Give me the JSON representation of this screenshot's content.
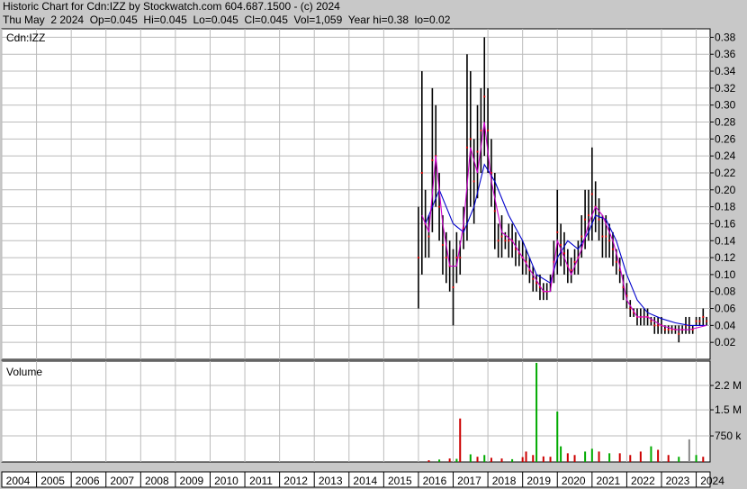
{
  "header": {
    "line1": "Historic Chart for Cdn:IZZ by Stockwatch.com 604.687.1500 - (c) 2024",
    "line2": "Thu May  2 2024  Op=0.045  Hi=0.045  Lo=0.045  Cl=0.045  Vol=1,059  Year hi=0.38  lo=0.02"
  },
  "chart_data": {
    "type": "line",
    "symbol_label": "Cdn:IZZ",
    "volume_label": "Volume",
    "x_ticks": [
      "2004",
      "2005",
      "2006",
      "2007",
      "2008",
      "2009",
      "2010",
      "2011",
      "2012",
      "2013",
      "2014",
      "2015",
      "2016",
      "2017",
      "2018",
      "2019",
      "2020",
      "2021",
      "2022",
      "2023",
      "2024"
    ],
    "x_range": [
      2004.0,
      2024.4
    ],
    "price": {
      "ylim": [
        0,
        0.39
      ],
      "y_ticks": [
        "0.02",
        "0.04",
        "0.06",
        "0.08",
        "0.10",
        "0.12",
        "0.14",
        "0.16",
        "0.18",
        "0.20",
        "0.22",
        "0.24",
        "0.26",
        "0.28",
        "0.30",
        "0.32",
        "0.34",
        "0.36",
        "0.38"
      ],
      "high_low": [
        {
          "t": 2016.0,
          "lo": 0.06,
          "hi": 0.18
        },
        {
          "t": 2016.1,
          "lo": 0.1,
          "hi": 0.34
        },
        {
          "t": 2016.2,
          "lo": 0.12,
          "hi": 0.2
        },
        {
          "t": 2016.3,
          "lo": 0.12,
          "hi": 0.17
        },
        {
          "t": 2016.4,
          "lo": 0.15,
          "hi": 0.32
        },
        {
          "t": 2016.5,
          "lo": 0.18,
          "hi": 0.3
        },
        {
          "t": 2016.6,
          "lo": 0.14,
          "hi": 0.22
        },
        {
          "t": 2016.7,
          "lo": 0.1,
          "hi": 0.17
        },
        {
          "t": 2016.8,
          "lo": 0.09,
          "hi": 0.15
        },
        {
          "t": 2016.9,
          "lo": 0.08,
          "hi": 0.14
        },
        {
          "t": 2017.0,
          "lo": 0.04,
          "hi": 0.13
        },
        {
          "t": 2017.1,
          "lo": 0.09,
          "hi": 0.15
        },
        {
          "t": 2017.2,
          "lo": 0.1,
          "hi": 0.14
        },
        {
          "t": 2017.3,
          "lo": 0.13,
          "hi": 0.18
        },
        {
          "t": 2017.4,
          "lo": 0.14,
          "hi": 0.36
        },
        {
          "t": 2017.5,
          "lo": 0.18,
          "hi": 0.34
        },
        {
          "t": 2017.6,
          "lo": 0.16,
          "hi": 0.26
        },
        {
          "t": 2017.7,
          "lo": 0.19,
          "hi": 0.3
        },
        {
          "t": 2017.8,
          "lo": 0.22,
          "hi": 0.32
        },
        {
          "t": 2017.9,
          "lo": 0.24,
          "hi": 0.38
        },
        {
          "t": 2018.0,
          "lo": 0.22,
          "hi": 0.32
        },
        {
          "t": 2018.1,
          "lo": 0.18,
          "hi": 0.26
        },
        {
          "t": 2018.2,
          "lo": 0.13,
          "hi": 0.22
        },
        {
          "t": 2018.3,
          "lo": 0.12,
          "hi": 0.16
        },
        {
          "t": 2018.4,
          "lo": 0.12,
          "hi": 0.17
        },
        {
          "t": 2018.5,
          "lo": 0.13,
          "hi": 0.15
        },
        {
          "t": 2018.6,
          "lo": 0.12,
          "hi": 0.16
        },
        {
          "t": 2018.7,
          "lo": 0.12,
          "hi": 0.16
        },
        {
          "t": 2018.8,
          "lo": 0.11,
          "hi": 0.15
        },
        {
          "t": 2018.9,
          "lo": 0.11,
          "hi": 0.14
        },
        {
          "t": 2019.0,
          "lo": 0.1,
          "hi": 0.14
        },
        {
          "t": 2019.1,
          "lo": 0.1,
          "hi": 0.13
        },
        {
          "t": 2019.2,
          "lo": 0.09,
          "hi": 0.12
        },
        {
          "t": 2019.3,
          "lo": 0.08,
          "hi": 0.11
        },
        {
          "t": 2019.4,
          "lo": 0.08,
          "hi": 0.1
        },
        {
          "t": 2019.5,
          "lo": 0.07,
          "hi": 0.1
        },
        {
          "t": 2019.6,
          "lo": 0.07,
          "hi": 0.09
        },
        {
          "t": 2019.7,
          "lo": 0.07,
          "hi": 0.09
        },
        {
          "t": 2019.8,
          "lo": 0.08,
          "hi": 0.1
        },
        {
          "t": 2019.9,
          "lo": 0.09,
          "hi": 0.14
        },
        {
          "t": 2020.0,
          "lo": 0.1,
          "hi": 0.2
        },
        {
          "t": 2020.1,
          "lo": 0.11,
          "hi": 0.16
        },
        {
          "t": 2020.2,
          "lo": 0.1,
          "hi": 0.15
        },
        {
          "t": 2020.3,
          "lo": 0.09,
          "hi": 0.13
        },
        {
          "t": 2020.4,
          "lo": 0.09,
          "hi": 0.12
        },
        {
          "t": 2020.5,
          "lo": 0.1,
          "hi": 0.13
        },
        {
          "t": 2020.6,
          "lo": 0.1,
          "hi": 0.14
        },
        {
          "t": 2020.7,
          "lo": 0.12,
          "hi": 0.17
        },
        {
          "t": 2020.8,
          "lo": 0.13,
          "hi": 0.2
        },
        {
          "t": 2020.9,
          "lo": 0.14,
          "hi": 0.2
        },
        {
          "t": 2021.0,
          "lo": 0.14,
          "hi": 0.25
        },
        {
          "t": 2021.1,
          "lo": 0.15,
          "hi": 0.21
        },
        {
          "t": 2021.2,
          "lo": 0.14,
          "hi": 0.19
        },
        {
          "t": 2021.3,
          "lo": 0.12,
          "hi": 0.17
        },
        {
          "t": 2021.4,
          "lo": 0.12,
          "hi": 0.17
        },
        {
          "t": 2021.5,
          "lo": 0.12,
          "hi": 0.16
        },
        {
          "t": 2021.6,
          "lo": 0.11,
          "hi": 0.15
        },
        {
          "t": 2021.7,
          "lo": 0.1,
          "hi": 0.13
        },
        {
          "t": 2021.8,
          "lo": 0.09,
          "hi": 0.12
        },
        {
          "t": 2021.9,
          "lo": 0.07,
          "hi": 0.1
        },
        {
          "t": 2022.0,
          "lo": 0.06,
          "hi": 0.09
        },
        {
          "t": 2022.1,
          "lo": 0.05,
          "hi": 0.07
        },
        {
          "t": 2022.2,
          "lo": 0.05,
          "hi": 0.06
        },
        {
          "t": 2022.3,
          "lo": 0.04,
          "hi": 0.06
        },
        {
          "t": 2022.4,
          "lo": 0.04,
          "hi": 0.06
        },
        {
          "t": 2022.5,
          "lo": 0.04,
          "hi": 0.06
        },
        {
          "t": 2022.6,
          "lo": 0.04,
          "hi": 0.06
        },
        {
          "t": 2022.7,
          "lo": 0.04,
          "hi": 0.05
        },
        {
          "t": 2022.8,
          "lo": 0.03,
          "hi": 0.05
        },
        {
          "t": 2022.9,
          "lo": 0.03,
          "hi": 0.05
        },
        {
          "t": 2023.0,
          "lo": 0.03,
          "hi": 0.05
        },
        {
          "t": 2023.1,
          "lo": 0.03,
          "hi": 0.04
        },
        {
          "t": 2023.2,
          "lo": 0.03,
          "hi": 0.04
        },
        {
          "t": 2023.3,
          "lo": 0.03,
          "hi": 0.04
        },
        {
          "t": 2023.4,
          "lo": 0.03,
          "hi": 0.04
        },
        {
          "t": 2023.5,
          "lo": 0.02,
          "hi": 0.04
        },
        {
          "t": 2023.6,
          "lo": 0.03,
          "hi": 0.04
        },
        {
          "t": 2023.7,
          "lo": 0.03,
          "hi": 0.05
        },
        {
          "t": 2023.8,
          "lo": 0.03,
          "hi": 0.05
        },
        {
          "t": 2023.9,
          "lo": 0.03,
          "hi": 0.04
        },
        {
          "t": 2024.0,
          "lo": 0.04,
          "hi": 0.05
        },
        {
          "t": 2024.1,
          "lo": 0.04,
          "hi": 0.05
        },
        {
          "t": 2024.2,
          "lo": 0.04,
          "hi": 0.06
        },
        {
          "t": 2024.3,
          "lo": 0.04,
          "hi": 0.05
        }
      ],
      "series": [
        {
          "color": "#0000cc",
          "points": [
            [
              2016.2,
              0.16
            ],
            [
              2016.6,
              0.2
            ],
            [
              2017.0,
              0.16
            ],
            [
              2017.3,
              0.15
            ],
            [
              2017.6,
              0.18
            ],
            [
              2017.9,
              0.23
            ],
            [
              2018.2,
              0.21
            ],
            [
              2018.6,
              0.17
            ],
            [
              2019.0,
              0.14
            ],
            [
              2019.4,
              0.1
            ],
            [
              2019.8,
              0.09
            ],
            [
              2020.0,
              0.12
            ],
            [
              2020.3,
              0.14
            ],
            [
              2020.6,
              0.13
            ],
            [
              2020.9,
              0.15
            ],
            [
              2021.1,
              0.17
            ],
            [
              2021.4,
              0.165
            ],
            [
              2021.7,
              0.14
            ],
            [
              2022.0,
              0.1
            ],
            [
              2022.3,
              0.07
            ],
            [
              2022.6,
              0.055
            ],
            [
              2023.0,
              0.048
            ],
            [
              2023.4,
              0.043
            ],
            [
              2023.8,
              0.04
            ],
            [
              2024.3,
              0.04
            ]
          ]
        },
        {
          "color": "#cc00cc",
          "points": [
            [
              2016.1,
              0.17
            ],
            [
              2016.3,
              0.15
            ],
            [
              2016.5,
              0.24
            ],
            [
              2016.7,
              0.16
            ],
            [
              2016.9,
              0.11
            ],
            [
              2017.1,
              0.11
            ],
            [
              2017.3,
              0.16
            ],
            [
              2017.5,
              0.25
            ],
            [
              2017.7,
              0.22
            ],
            [
              2017.9,
              0.28
            ],
            [
              2018.1,
              0.21
            ],
            [
              2018.4,
              0.15
            ],
            [
              2018.7,
              0.14
            ],
            [
              2019.0,
              0.12
            ],
            [
              2019.3,
              0.1
            ],
            [
              2019.6,
              0.08
            ],
            [
              2019.8,
              0.08
            ],
            [
              2020.0,
              0.14
            ],
            [
              2020.2,
              0.12
            ],
            [
              2020.4,
              0.1
            ],
            [
              2020.7,
              0.13
            ],
            [
              2020.9,
              0.16
            ],
            [
              2021.1,
              0.18
            ],
            [
              2021.3,
              0.17
            ],
            [
              2021.6,
              0.14
            ],
            [
              2021.8,
              0.11
            ],
            [
              2022.0,
              0.07
            ],
            [
              2022.3,
              0.05
            ],
            [
              2022.6,
              0.05
            ],
            [
              2023.0,
              0.04
            ],
            [
              2023.4,
              0.035
            ],
            [
              2023.8,
              0.035
            ],
            [
              2024.3,
              0.04
            ]
          ]
        }
      ]
    },
    "volume": {
      "ylim": [
        0,
        2.9
      ],
      "unit": "M",
      "y_ticks": [
        {
          "label": "750 k",
          "v": 0.75
        },
        {
          "label": "1.5 M",
          "v": 1.5
        },
        {
          "label": "2.2 M",
          "v": 2.2
        }
      ],
      "bars": [
        {
          "t": 2016.3,
          "v": 0.05,
          "c": "#cc0000"
        },
        {
          "t": 2016.6,
          "v": 0.07,
          "c": "#00aa00"
        },
        {
          "t": 2016.9,
          "v": 0.1,
          "c": "#cc0000"
        },
        {
          "t": 2017.1,
          "v": 0.09,
          "c": "#00aa00"
        },
        {
          "t": 2017.2,
          "v": 1.25,
          "c": "#cc0000"
        },
        {
          "t": 2017.5,
          "v": 0.22,
          "c": "#00aa00"
        },
        {
          "t": 2017.7,
          "v": 0.15,
          "c": "#cc0000"
        },
        {
          "t": 2017.9,
          "v": 0.2,
          "c": "#00aa00"
        },
        {
          "t": 2018.1,
          "v": 0.12,
          "c": "#cc0000"
        },
        {
          "t": 2018.4,
          "v": 0.1,
          "c": "#cc0000"
        },
        {
          "t": 2018.7,
          "v": 0.08,
          "c": "#00aa00"
        },
        {
          "t": 2019.0,
          "v": 0.14,
          "c": "#cc0000"
        },
        {
          "t": 2019.1,
          "v": 0.3,
          "c": "#cc0000"
        },
        {
          "t": 2019.3,
          "v": 0.2,
          "c": "#cc0000"
        },
        {
          "t": 2019.4,
          "v": 2.85,
          "c": "#00aa00"
        },
        {
          "t": 2019.6,
          "v": 0.16,
          "c": "#cc0000"
        },
        {
          "t": 2019.8,
          "v": 0.15,
          "c": "#cc0000"
        },
        {
          "t": 2020.0,
          "v": 1.45,
          "c": "#00aa00"
        },
        {
          "t": 2020.1,
          "v": 0.45,
          "c": "#00aa00"
        },
        {
          "t": 2020.3,
          "v": 0.25,
          "c": "#cc0000"
        },
        {
          "t": 2020.5,
          "v": 0.2,
          "c": "#cc0000"
        },
        {
          "t": 2020.8,
          "v": 0.3,
          "c": "#00aa00"
        },
        {
          "t": 2021.0,
          "v": 0.38,
          "c": "#00aa00"
        },
        {
          "t": 2021.2,
          "v": 0.3,
          "c": "#cc0000"
        },
        {
          "t": 2021.5,
          "v": 0.25,
          "c": "#00aa00"
        },
        {
          "t": 2021.8,
          "v": 0.25,
          "c": "#cc0000"
        },
        {
          "t": 2022.1,
          "v": 0.2,
          "c": "#cc0000"
        },
        {
          "t": 2022.4,
          "v": 0.3,
          "c": "#cc0000"
        },
        {
          "t": 2022.7,
          "v": 0.45,
          "c": "#00aa00"
        },
        {
          "t": 2022.9,
          "v": 0.35,
          "c": "#cc0000"
        },
        {
          "t": 2023.2,
          "v": 0.2,
          "c": "#cc0000"
        },
        {
          "t": 2023.5,
          "v": 0.15,
          "c": "#00aa00"
        },
        {
          "t": 2023.8,
          "v": 0.65,
          "c": "#888888"
        },
        {
          "t": 2024.0,
          "v": 0.2,
          "c": "#00aa00"
        },
        {
          "t": 2024.2,
          "v": 0.15,
          "c": "#cc0000"
        }
      ]
    }
  }
}
